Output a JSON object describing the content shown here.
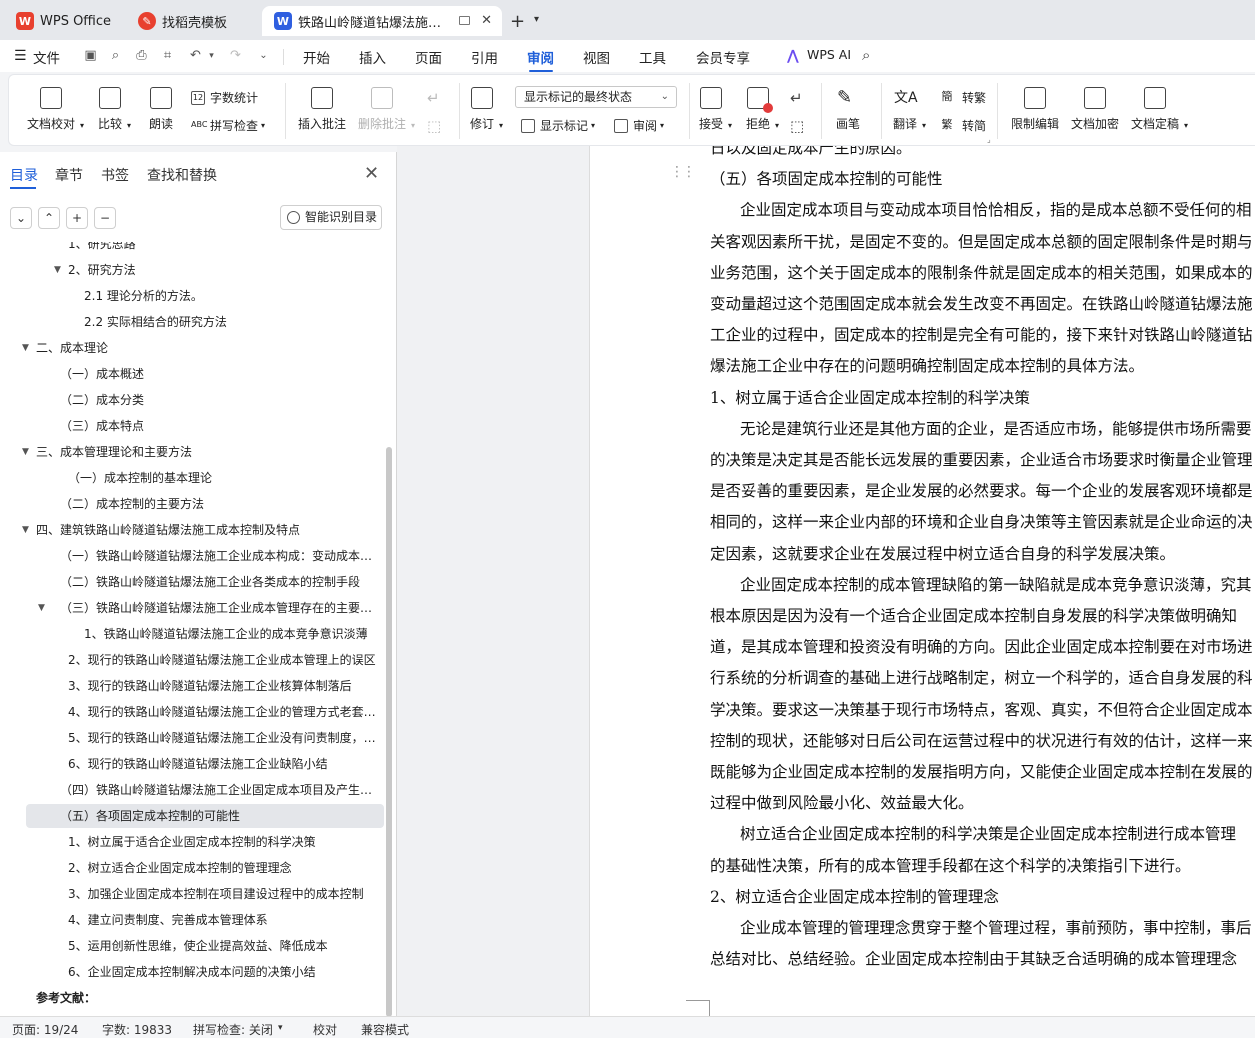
{
  "tabs": {
    "wps": "WPS Office",
    "daoke": "找稻壳模板",
    "doc": "铁路山岭隧道钻爆法施工成本控制",
    "close": "✕",
    "new": "+",
    "dropdown": "⌄"
  },
  "menu": {
    "file": "文件",
    "items": [
      "开始",
      "插入",
      "页面",
      "引用",
      "审阅",
      "视图",
      "工具",
      "会员专享",
      "WPS AI"
    ]
  },
  "ribbon": {
    "doc_check": "文档校对",
    "compare": "比较",
    "read_aloud": "朗读",
    "word_count": "字数统计",
    "spell_check": "拼写检查",
    "insert_comment": "插入批注",
    "delete_comment": "删除批注",
    "track_changes": "修订",
    "markup_state": "显示标记的最终状态",
    "show_markup": "显示标记",
    "review_pane": "审阅",
    "accept": "接受",
    "reject": "拒绝",
    "pen": "画笔",
    "translate": "翻译",
    "to_traditional": "转繁",
    "to_simplified": "转简",
    "restrict_edit": "限制编辑",
    "encrypt": "文档加密",
    "finalize": "文档定稿"
  },
  "nav": {
    "tabs": [
      "目录",
      "章节",
      "书签",
      "查找和替换"
    ],
    "close": "✕",
    "smart_toc": "智能识别目录",
    "toc": [
      {
        "text": "1、研究思路",
        "indent": 2,
        "tri": ""
      },
      {
        "text": "2、研究方法",
        "indent": 2,
        "tri": "▼"
      },
      {
        "text": "2.1 理论分析的方法。",
        "indent": 3,
        "tri": ""
      },
      {
        "text": "2.2 实际相结合的研究方法",
        "indent": 3,
        "tri": ""
      },
      {
        "text": "二、成本理论",
        "indent": 0,
        "tri": "▼"
      },
      {
        "text": "（一）成本概述",
        "indent": 1,
        "tri": ""
      },
      {
        "text": "（二）成本分类",
        "indent": 1,
        "tri": ""
      },
      {
        "text": "（三）成本特点",
        "indent": 1,
        "tri": ""
      },
      {
        "text": "三、成本管理理论和主要方法",
        "indent": 0,
        "tri": "▼"
      },
      {
        "text": "（一）成本控制的基本理论",
        "indent": 2,
        "tri": ""
      },
      {
        "text": "（二）成本控制的主要方法",
        "indent": 1,
        "tri": ""
      },
      {
        "text": "四、建筑铁路山岭隧道钻爆法施工成本控制及特点",
        "indent": 0,
        "tri": "▼"
      },
      {
        "text": "（一）铁路山岭隧道钻爆法施工企业成本构成：变动成本项目和固定成本项目",
        "indent": 1,
        "tri": ""
      },
      {
        "text": "（二）铁路山岭隧道钻爆法施工企业各类成本的控制手段",
        "indent": 1,
        "tri": ""
      },
      {
        "text": "（三）铁路山岭隧道钻爆法施工企业成本管理存在的主要问题",
        "indent": 1,
        "tri": "▼"
      },
      {
        "text": "1、铁路山岭隧道钻爆法施工企业的成本竞争意识淡薄",
        "indent": 3,
        "tri": ""
      },
      {
        "text": "2、现行的铁路山岭隧道钻爆法施工企业成本管理上的误区",
        "indent": 2,
        "tri": ""
      },
      {
        "text": "3、现行的铁路山岭隧道钻爆法施工企业核算体制落后",
        "indent": 2,
        "tri": ""
      },
      {
        "text": "4、现行的铁路山岭隧道钻爆法施工企业的管理方式老套落后",
        "indent": 2,
        "tri": ""
      },
      {
        "text": "5、现行的铁路山岭隧道钻爆法施工企业没有问责制度，责任不明确",
        "indent": 2,
        "tri": ""
      },
      {
        "text": "6、现行的铁路山岭隧道钻爆法施工企业缺陷小结",
        "indent": 2,
        "tri": ""
      },
      {
        "text": "（四）铁路山岭隧道钻爆法施工企业固定成本项目及产生的原因",
        "indent": 1,
        "tri": ""
      },
      {
        "text": "（五）各项固定成本控制的可能性",
        "indent": 1,
        "tri": "▼",
        "selected": true
      },
      {
        "text": "1、树立属于适合企业固定成本控制的科学决策",
        "indent": 2,
        "tri": ""
      },
      {
        "text": "2、树立适合企业固定成本控制的管理理念",
        "indent": 2,
        "tri": ""
      },
      {
        "text": "3、加强企业固定成本控制在项目建设过程中的成本控制",
        "indent": 2,
        "tri": ""
      },
      {
        "text": "4、建立问责制度、完善成本管理体系",
        "indent": 2,
        "tri": ""
      },
      {
        "text": "5、运用创新性思维，使企业提高效益、降低成本",
        "indent": 2,
        "tri": ""
      },
      {
        "text": "6、企业固定成本控制解决成本问题的决策小结",
        "indent": 2,
        "tri": ""
      },
      {
        "text": "参考文献：",
        "indent": 0,
        "tri": "",
        "bold": true
      }
    ]
  },
  "doc": {
    "lines": [
      {
        "t": "日以及固定成本产生的原因。",
        "ind": false
      },
      {
        "t": "（五）各项固定成本控制的可能性",
        "ind": false
      },
      {
        "t": "企业固定成本项目与变动成本项目恰恰相反，指的是成本总额不受任何的相",
        "ind": true
      },
      {
        "t": "关客观因素所干扰，是固定不变的。但是固定成本总额的固定限制条件是时期与",
        "ind": false
      },
      {
        "t": "业务范围，这个关于固定成本的限制条件就是固定成本的相关范围，如果成本的",
        "ind": false
      },
      {
        "t": "变动量超过这个范围固定成本就会发生改变不再固定。在铁路山岭隧道钻爆法施",
        "ind": false
      },
      {
        "t": "工企业的过程中，固定成本的控制是完全有可能的，接下来针对铁路山岭隧道钻",
        "ind": false
      },
      {
        "t": "爆法施工企业中存在的问题明确控制固定成本控制的具体方法。",
        "ind": false
      },
      {
        "t": "1、树立属于适合企业固定成本控制的科学决策",
        "ind": false
      },
      {
        "t": "无论是建筑行业还是其他方面的企业，是否适应市场，能够提供市场所需要",
        "ind": true
      },
      {
        "t": "的决策是决定其是否能长远发展的重要因素，企业适合市场要求时衡量企业管理",
        "ind": false
      },
      {
        "t": "是否妥善的重要因素，是企业发展的必然要求。每一个企业的发展客观环境都是",
        "ind": false
      },
      {
        "t": "相同的，这样一来企业内部的环境和企业自身决策等主管因素就是企业命运的决",
        "ind": false
      },
      {
        "t": "定因素，这就要求企业在发展过程中树立适合自身的科学发展决策。",
        "ind": false
      },
      {
        "t": "企业固定成本控制的成本管理缺陷的第一缺陷就是成本竞争意识淡薄，究其",
        "ind": true
      },
      {
        "t": "根本原因是因为没有一个适合企业固定成本控制自身发展的科学决策做明确知",
        "ind": false
      },
      {
        "t": "道，是其成本管理和投资没有明确的方向。因此企业固定成本控制要在对市场进",
        "ind": false
      },
      {
        "t": "行系统的分析调查的基础上进行战略制定，树立一个科学的，适合自身发展的科",
        "ind": false
      },
      {
        "t": "学决策。要求这一决策基于现行市场特点，客观、真实，不但符合企业固定成本",
        "ind": false
      },
      {
        "t": "控制的现状，还能够对日后公司在运营过程中的状况进行有效的估计，这样一来",
        "ind": false
      },
      {
        "t": "既能够为企业固定成本控制的发展指明方向，又能使企业固定成本控制在发展的",
        "ind": false
      },
      {
        "t": "过程中做到风险最小化、效益最大化。",
        "ind": false
      },
      {
        "t": "树立适合企业固定成本控制的科学决策是企业固定成本控制进行成本管理",
        "ind": true
      },
      {
        "t": "的基础性决策，所有的成本管理手段都在这个科学的决策指引下进行。",
        "ind": false
      },
      {
        "t": "2、树立适合企业固定成本控制的管理理念",
        "ind": false
      },
      {
        "t": "企业成本管理的管理理念贯穿于整个管理过程，事前预防，事中控制，事后",
        "ind": true
      },
      {
        "t": "总结对比、总结经验。企业固定成本控制由于其缺乏合适明确的成本管理理念",
        "ind": false
      }
    ]
  },
  "status": {
    "page": "页面: 19/24",
    "words": "字数: 19833",
    "spell": "拼写检查: 关闭",
    "proof": "校对",
    "compat": "兼容模式"
  }
}
